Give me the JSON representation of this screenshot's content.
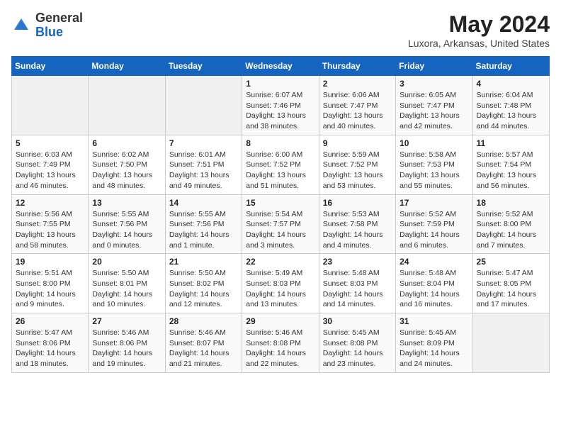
{
  "header": {
    "logo_line1": "General",
    "logo_line2": "Blue",
    "month": "May 2024",
    "location": "Luxora, Arkansas, United States"
  },
  "weekdays": [
    "Sunday",
    "Monday",
    "Tuesday",
    "Wednesday",
    "Thursday",
    "Friday",
    "Saturday"
  ],
  "weeks": [
    [
      {
        "day": "",
        "info": ""
      },
      {
        "day": "",
        "info": ""
      },
      {
        "day": "",
        "info": ""
      },
      {
        "day": "1",
        "info": "Sunrise: 6:07 AM\nSunset: 7:46 PM\nDaylight: 13 hours\nand 38 minutes."
      },
      {
        "day": "2",
        "info": "Sunrise: 6:06 AM\nSunset: 7:47 PM\nDaylight: 13 hours\nand 40 minutes."
      },
      {
        "day": "3",
        "info": "Sunrise: 6:05 AM\nSunset: 7:47 PM\nDaylight: 13 hours\nand 42 minutes."
      },
      {
        "day": "4",
        "info": "Sunrise: 6:04 AM\nSunset: 7:48 PM\nDaylight: 13 hours\nand 44 minutes."
      }
    ],
    [
      {
        "day": "5",
        "info": "Sunrise: 6:03 AM\nSunset: 7:49 PM\nDaylight: 13 hours\nand 46 minutes."
      },
      {
        "day": "6",
        "info": "Sunrise: 6:02 AM\nSunset: 7:50 PM\nDaylight: 13 hours\nand 48 minutes."
      },
      {
        "day": "7",
        "info": "Sunrise: 6:01 AM\nSunset: 7:51 PM\nDaylight: 13 hours\nand 49 minutes."
      },
      {
        "day": "8",
        "info": "Sunrise: 6:00 AM\nSunset: 7:52 PM\nDaylight: 13 hours\nand 51 minutes."
      },
      {
        "day": "9",
        "info": "Sunrise: 5:59 AM\nSunset: 7:52 PM\nDaylight: 13 hours\nand 53 minutes."
      },
      {
        "day": "10",
        "info": "Sunrise: 5:58 AM\nSunset: 7:53 PM\nDaylight: 13 hours\nand 55 minutes."
      },
      {
        "day": "11",
        "info": "Sunrise: 5:57 AM\nSunset: 7:54 PM\nDaylight: 13 hours\nand 56 minutes."
      }
    ],
    [
      {
        "day": "12",
        "info": "Sunrise: 5:56 AM\nSunset: 7:55 PM\nDaylight: 13 hours\nand 58 minutes."
      },
      {
        "day": "13",
        "info": "Sunrise: 5:55 AM\nSunset: 7:56 PM\nDaylight: 14 hours\nand 0 minutes."
      },
      {
        "day": "14",
        "info": "Sunrise: 5:55 AM\nSunset: 7:56 PM\nDaylight: 14 hours\nand 1 minute."
      },
      {
        "day": "15",
        "info": "Sunrise: 5:54 AM\nSunset: 7:57 PM\nDaylight: 14 hours\nand 3 minutes."
      },
      {
        "day": "16",
        "info": "Sunrise: 5:53 AM\nSunset: 7:58 PM\nDaylight: 14 hours\nand 4 minutes."
      },
      {
        "day": "17",
        "info": "Sunrise: 5:52 AM\nSunset: 7:59 PM\nDaylight: 14 hours\nand 6 minutes."
      },
      {
        "day": "18",
        "info": "Sunrise: 5:52 AM\nSunset: 8:00 PM\nDaylight: 14 hours\nand 7 minutes."
      }
    ],
    [
      {
        "day": "19",
        "info": "Sunrise: 5:51 AM\nSunset: 8:00 PM\nDaylight: 14 hours\nand 9 minutes."
      },
      {
        "day": "20",
        "info": "Sunrise: 5:50 AM\nSunset: 8:01 PM\nDaylight: 14 hours\nand 10 minutes."
      },
      {
        "day": "21",
        "info": "Sunrise: 5:50 AM\nSunset: 8:02 PM\nDaylight: 14 hours\nand 12 minutes."
      },
      {
        "day": "22",
        "info": "Sunrise: 5:49 AM\nSunset: 8:03 PM\nDaylight: 14 hours\nand 13 minutes."
      },
      {
        "day": "23",
        "info": "Sunrise: 5:48 AM\nSunset: 8:03 PM\nDaylight: 14 hours\nand 14 minutes."
      },
      {
        "day": "24",
        "info": "Sunrise: 5:48 AM\nSunset: 8:04 PM\nDaylight: 14 hours\nand 16 minutes."
      },
      {
        "day": "25",
        "info": "Sunrise: 5:47 AM\nSunset: 8:05 PM\nDaylight: 14 hours\nand 17 minutes."
      }
    ],
    [
      {
        "day": "26",
        "info": "Sunrise: 5:47 AM\nSunset: 8:06 PM\nDaylight: 14 hours\nand 18 minutes."
      },
      {
        "day": "27",
        "info": "Sunrise: 5:46 AM\nSunset: 8:06 PM\nDaylight: 14 hours\nand 19 minutes."
      },
      {
        "day": "28",
        "info": "Sunrise: 5:46 AM\nSunset: 8:07 PM\nDaylight: 14 hours\nand 21 minutes."
      },
      {
        "day": "29",
        "info": "Sunrise: 5:46 AM\nSunset: 8:08 PM\nDaylight: 14 hours\nand 22 minutes."
      },
      {
        "day": "30",
        "info": "Sunrise: 5:45 AM\nSunset: 8:08 PM\nDaylight: 14 hours\nand 23 minutes."
      },
      {
        "day": "31",
        "info": "Sunrise: 5:45 AM\nSunset: 8:09 PM\nDaylight: 14 hours\nand 24 minutes."
      },
      {
        "day": "",
        "info": ""
      }
    ]
  ]
}
